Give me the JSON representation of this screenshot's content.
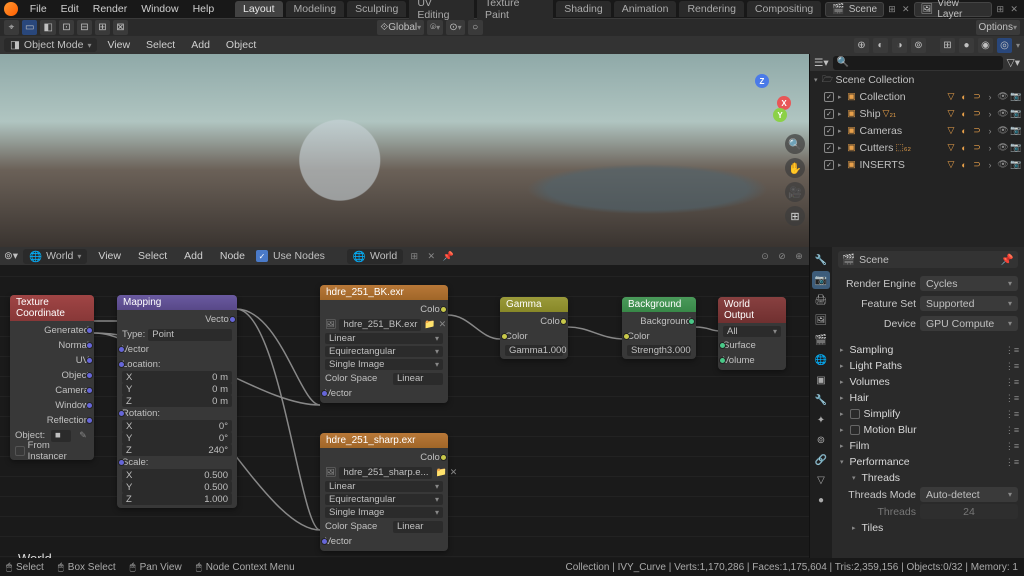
{
  "menus": [
    "File",
    "Edit",
    "Render",
    "Window",
    "Help"
  ],
  "workspaces": [
    "Layout",
    "Modeling",
    "Sculpting",
    "UV Editing",
    "Texture Paint",
    "Shading",
    "Animation",
    "Rendering",
    "Compositing"
  ],
  "active_workspace": "Layout",
  "scene_name": "Scene",
  "view_layer": "View Layer",
  "options_label": "Options",
  "global_label": "Global",
  "viewport": {
    "mode": "Object Mode",
    "menus": [
      "View",
      "Select",
      "Add",
      "Object"
    ]
  },
  "outliner": {
    "search_placeholder": "",
    "root": "Scene Collection",
    "items": [
      {
        "name": "Collection",
        "icon": "▣",
        "badge": ""
      },
      {
        "name": "Ship",
        "icon": "▣",
        "badge": "▽₂₁"
      },
      {
        "name": "Cameras",
        "icon": "▣",
        "badge": ""
      },
      {
        "name": "Cutters",
        "icon": "▣",
        "badge": "⬚₆₂"
      },
      {
        "name": "INSERTS",
        "icon": "▣",
        "badge": ""
      }
    ]
  },
  "node_editor": {
    "type_label": "World",
    "menus": [
      "View",
      "Select",
      "Add",
      "Node"
    ],
    "use_nodes_label": "Use Nodes",
    "world_name": "World",
    "bottom_label": "World"
  },
  "nodes": {
    "tex_coord": {
      "title": "Texture Coordinate",
      "outs": [
        "Generated",
        "Normal",
        "UV",
        "Object",
        "Camera",
        "Window",
        "Reflection"
      ],
      "object_label": "Object:",
      "instancer": "From Instancer"
    },
    "mapping": {
      "title": "Mapping",
      "vector_out": "Vector",
      "type_label": "Type:",
      "type_val": "Point",
      "vector_in": "Vector",
      "loc": "Location:",
      "rot": "Rotation:",
      "scale": "Scale:",
      "loc_vals": [
        "0 m",
        "0 m",
        "0 m"
      ],
      "rot_vals": [
        "0°",
        "0°",
        "240°"
      ],
      "scale_vals": [
        "0.500",
        "0.500",
        "1.000"
      ],
      "axes": [
        "X",
        "Y",
        "Z"
      ]
    },
    "env1": {
      "title": "hdre_251_BK.exr",
      "out": "Color",
      "file": "hdre_251_BK.exr",
      "proj": "Linear",
      "interp": "Equirectangular",
      "single": "Single Image",
      "cs_label": "Color Space",
      "cs": "Linear",
      "vec": "Vector"
    },
    "env2": {
      "title": "hdre_251_sharp.exr",
      "out": "Color",
      "file": "hdre_251_sharp.e...",
      "proj": "Linear",
      "interp": "Equirectangular",
      "single": "Single Image",
      "cs_label": "Color Space",
      "cs": "Linear",
      "vec": "Vector"
    },
    "gamma": {
      "title": "Gamma",
      "out": "Color",
      "in": "Color",
      "g_label": "Gamma",
      "g_val": "1.000"
    },
    "bg": {
      "title": "Background",
      "out": "Background",
      "in": "Color",
      "s_label": "Strength",
      "s_val": "3.000"
    },
    "out": {
      "title": "World Output",
      "target": "All",
      "surf": "Surface",
      "vol": "Volume"
    }
  },
  "props": {
    "scene_label": "Scene",
    "engine_label": "Render Engine",
    "engine_val": "Cycles",
    "feature_label": "Feature Set",
    "feature_val": "Supported",
    "device_label": "Device",
    "device_val": "GPU Compute",
    "sections": [
      "Sampling",
      "Light Paths",
      "Volumes",
      "Hair",
      "Simplify",
      "Motion Blur",
      "Film",
      "Performance"
    ],
    "perf_sub": "Threads",
    "threads_mode_label": "Threads Mode",
    "threads_mode_val": "Auto-detect",
    "threads_label": "Threads",
    "threads_val": "24",
    "tiles": "Tiles"
  },
  "status": {
    "select": "Select",
    "box": "Box Select",
    "pan": "Pan View",
    "ctx": "Node Context Menu",
    "right": "Collection | IVY_Curve | Verts:1,170,286 | Faces:1,175,604 | Tris:2,359,156 | Objects:0/32 | Memory: 1"
  }
}
